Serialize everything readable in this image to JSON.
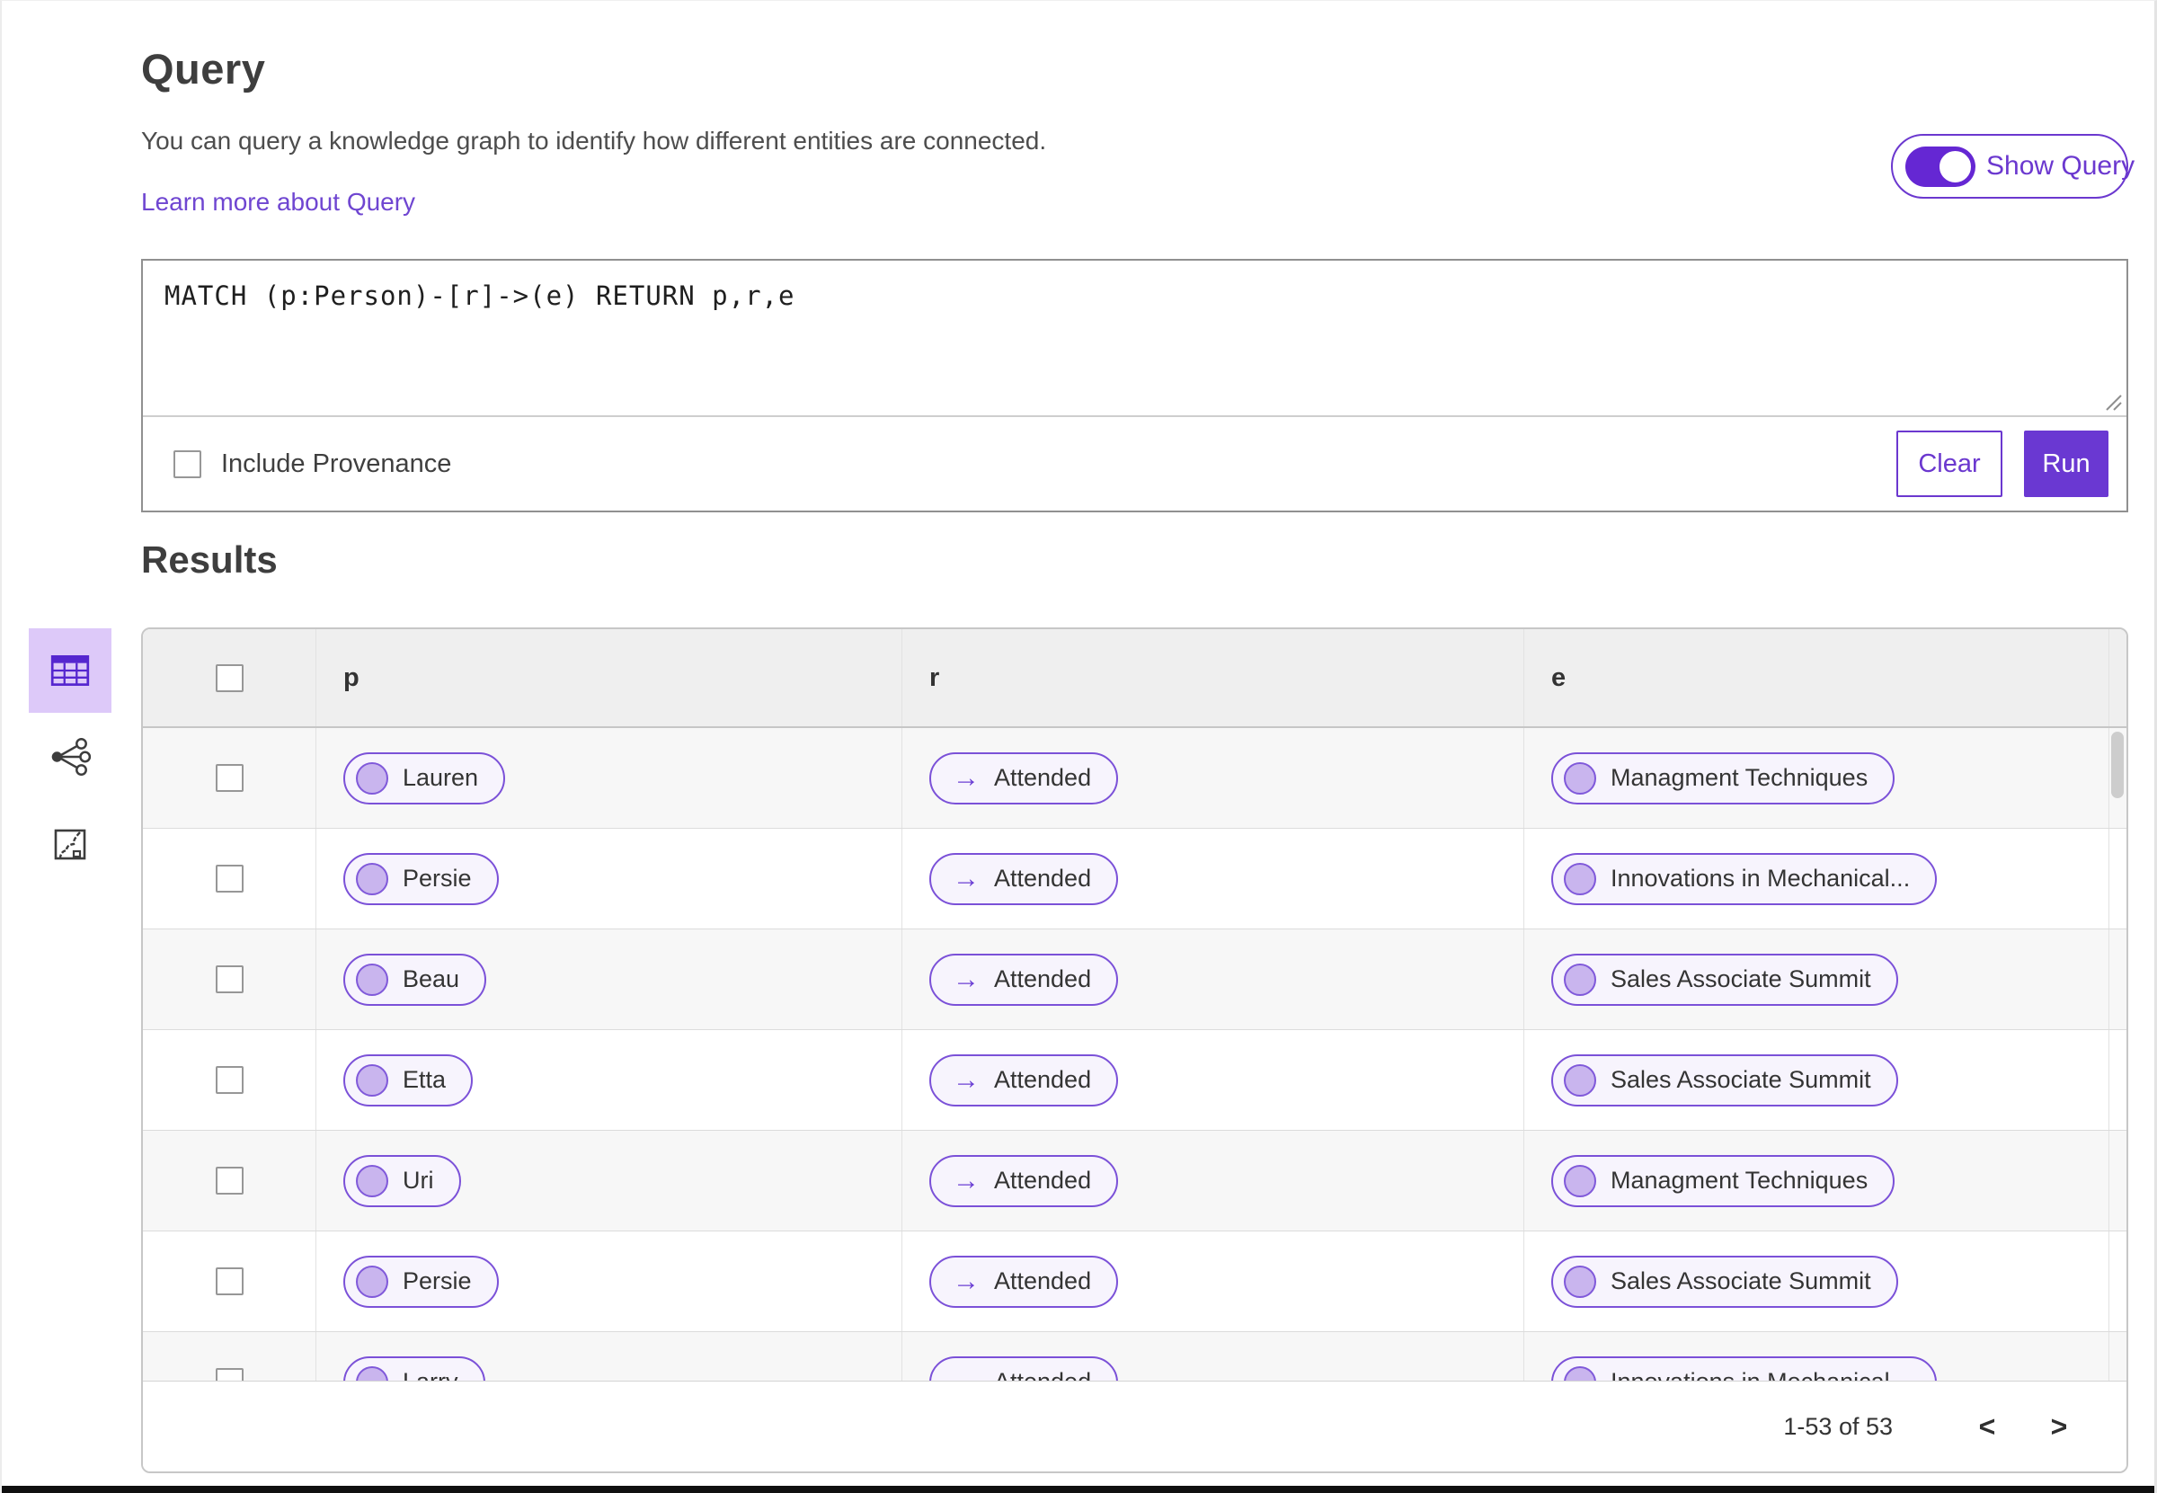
{
  "query": {
    "title": "Query",
    "description": "You can query a knowledge graph to identify how different entities are connected.",
    "learn_more_link": "Learn more about Query",
    "show_query_label": "Show Query",
    "show_query_state": "on",
    "query_text": "MATCH (p:Person)-[r]->(e) RETURN p,r,e",
    "include_provenance_label": "Include Provenance",
    "include_provenance_checked": false,
    "clear_button": "Clear",
    "run_button": "Run"
  },
  "results": {
    "title": "Results",
    "view_modes": [
      {
        "icon": "table-view-icon",
        "selected": true
      },
      {
        "icon": "graph-view-icon",
        "selected": false
      },
      {
        "icon": "chart-view-icon",
        "selected": false
      }
    ],
    "table": {
      "columns": [
        "p",
        "r",
        "e"
      ],
      "arrow_glyph": "→",
      "rows": [
        {
          "p": "Lauren",
          "r": "Attended",
          "e": "Managment Techniques"
        },
        {
          "p": "Persie",
          "r": "Attended",
          "e": "Innovations in Mechanical..."
        },
        {
          "p": "Beau",
          "r": "Attended",
          "e": "Sales Associate Summit"
        },
        {
          "p": "Etta",
          "r": "Attended",
          "e": "Sales Associate Summit"
        },
        {
          "p": "Uri",
          "r": "Attended",
          "e": "Managment Techniques"
        },
        {
          "p": "Persie",
          "r": "Attended",
          "e": "Sales Associate Summit"
        },
        {
          "p": "Larry",
          "r": "Attended",
          "e": "Innovations in Mechanical..."
        }
      ],
      "pagination": {
        "range_label": "1-53 of 53",
        "prev_glyph": "<",
        "next_glyph": ">"
      }
    }
  },
  "colors": {
    "primary_purple": "#6a38d2",
    "pill_border": "#7b51d8",
    "pill_background": "#f7f4fd",
    "node_circle_fill": "#c9b5ee",
    "selected_tile_background": "#ddc9f9",
    "link_purple": "#6f46d1",
    "header_row_background": "#efefef",
    "alt_row_background": "#f7f7f7"
  }
}
